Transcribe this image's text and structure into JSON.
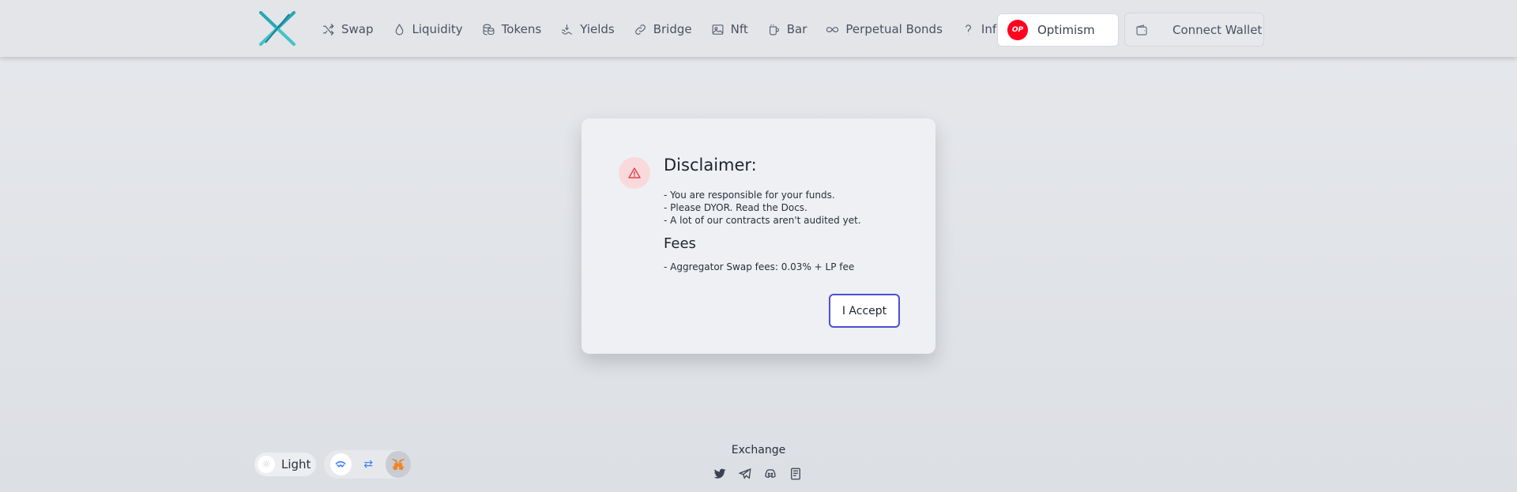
{
  "header": {
    "nav": [
      {
        "label": "Swap",
        "icon": "shuffle-icon"
      },
      {
        "label": "Liquidity",
        "icon": "droplet-icon"
      },
      {
        "label": "Tokens",
        "icon": "coins-icon"
      },
      {
        "label": "Yields",
        "icon": "yield-icon"
      },
      {
        "label": "Bridge",
        "icon": "link-icon"
      },
      {
        "label": "Nft",
        "icon": "image-icon"
      },
      {
        "label": "Bar",
        "icon": "mug-icon"
      },
      {
        "label": "Perpetual Bonds",
        "icon": "infinity-icon"
      },
      {
        "label": "Info",
        "icon": "question-icon"
      }
    ],
    "network": {
      "label": "Optimism",
      "badge": "OP",
      "badge_color": "#ff0420"
    },
    "wallet_button": "Connect Wallet"
  },
  "modal": {
    "title": "Disclaimer:",
    "lines": [
      "- You are responsible for your funds.",
      "- Please DYOR. Read the Docs.",
      "- A lot of our contracts aren't audited yet."
    ],
    "fees_title": "Fees",
    "fee_line": "- Aggregator Swap fees: 0.03% + LP fee",
    "accept_label": "I Accept"
  },
  "footer": {
    "theme_label": "Light",
    "title": "Exchange"
  },
  "colors": {
    "accent": "#4c4fd6",
    "warning_bg": "#f9d9dc",
    "warning": "#e5484d"
  }
}
